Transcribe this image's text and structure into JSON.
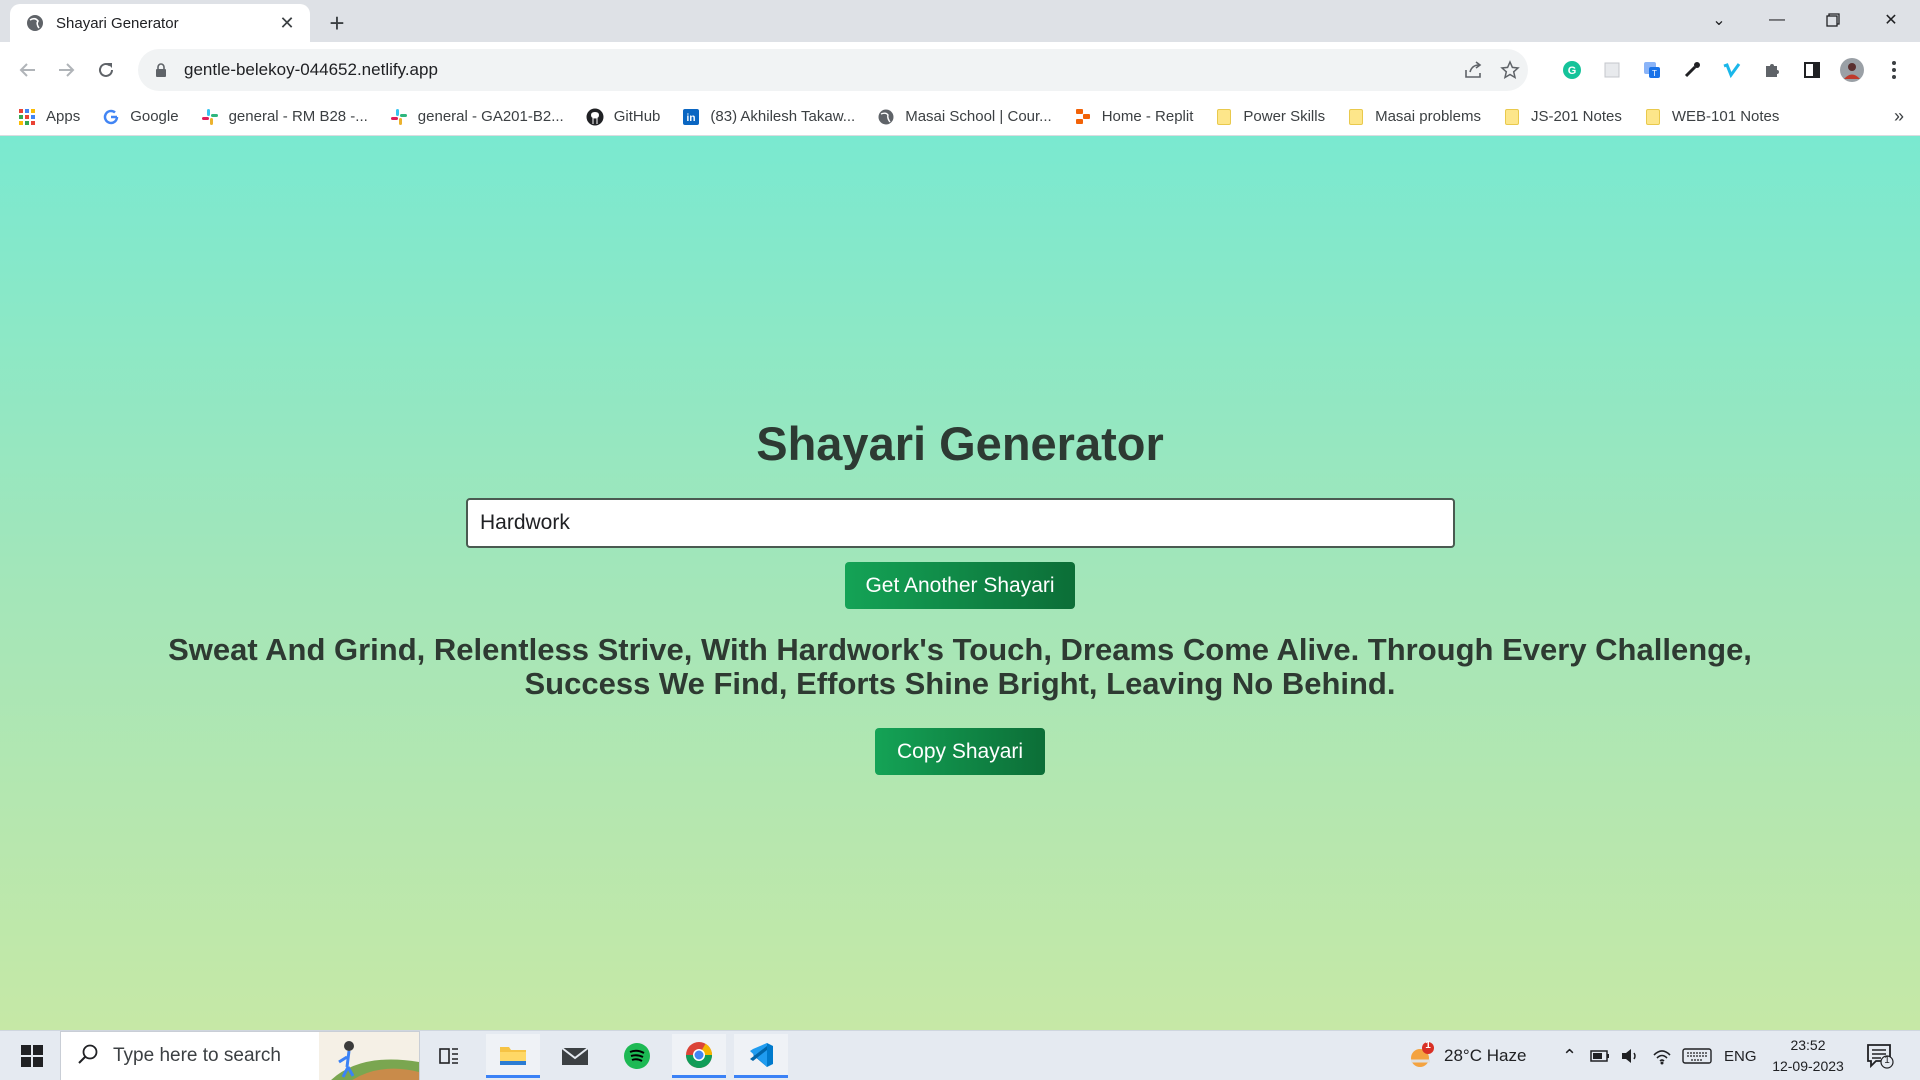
{
  "browser": {
    "tab_title": "Shayari Generator",
    "url": "gentle-belekoy-044652.netlify.app"
  },
  "bookmarks": [
    {
      "label": "Apps",
      "icon": "apps-grid-icon"
    },
    {
      "label": "Google",
      "icon": "google-icon"
    },
    {
      "label": "general - RM B28 -...",
      "icon": "slack-icon"
    },
    {
      "label": "general - GA201-B2...",
      "icon": "slack-icon"
    },
    {
      "label": "GitHub",
      "icon": "github-icon"
    },
    {
      "label": "(83) Akhilesh Takaw...",
      "icon": "linkedin-icon"
    },
    {
      "label": "Masai School | Cour...",
      "icon": "globe-icon"
    },
    {
      "label": "Home - Replit",
      "icon": "replit-icon"
    },
    {
      "label": "Power Skills",
      "icon": "folder-icon"
    },
    {
      "label": "Masai problems",
      "icon": "folder-icon"
    },
    {
      "label": "JS-201 Notes",
      "icon": "folder-icon"
    },
    {
      "label": "WEB-101 Notes",
      "icon": "folder-icon"
    }
  ],
  "page": {
    "title": "Shayari Generator",
    "topic_value": "Hardwork",
    "get_button": "Get Another Shayari",
    "shayari_line1": "Sweat And Grind, Relentless Strive, With Hardwork's Touch, Dreams Come Alive. Through Every Challenge,",
    "shayari_line2": "Success We Find, Efforts Shine Bright, Leaving No Behind.",
    "copy_button": "Copy Shayari"
  },
  "taskbar": {
    "search_placeholder": "Type here to search",
    "weather": "28°C  Haze",
    "weather_badge": "1",
    "language": "ENG",
    "time": "23:52",
    "date": "12-09-2023",
    "notification_count": "1"
  },
  "colors": {
    "gradient_top": "#7ae9d0",
    "gradient_bottom": "#c6e8a6",
    "button_green": "#14a356"
  }
}
